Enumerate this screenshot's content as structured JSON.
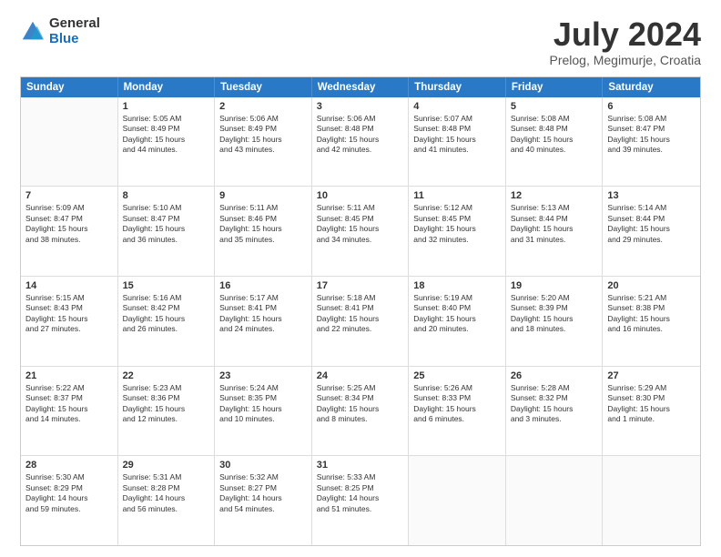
{
  "logo": {
    "general": "General",
    "blue": "Blue"
  },
  "header": {
    "title": "July 2024",
    "subtitle": "Prelog, Megimurje, Croatia"
  },
  "weekdays": [
    "Sunday",
    "Monday",
    "Tuesday",
    "Wednesday",
    "Thursday",
    "Friday",
    "Saturday"
  ],
  "weeks": [
    [
      {
        "day": "",
        "lines": []
      },
      {
        "day": "1",
        "lines": [
          "Sunrise: 5:05 AM",
          "Sunset: 8:49 PM",
          "Daylight: 15 hours",
          "and 44 minutes."
        ]
      },
      {
        "day": "2",
        "lines": [
          "Sunrise: 5:06 AM",
          "Sunset: 8:49 PM",
          "Daylight: 15 hours",
          "and 43 minutes."
        ]
      },
      {
        "day": "3",
        "lines": [
          "Sunrise: 5:06 AM",
          "Sunset: 8:48 PM",
          "Daylight: 15 hours",
          "and 42 minutes."
        ]
      },
      {
        "day": "4",
        "lines": [
          "Sunrise: 5:07 AM",
          "Sunset: 8:48 PM",
          "Daylight: 15 hours",
          "and 41 minutes."
        ]
      },
      {
        "day": "5",
        "lines": [
          "Sunrise: 5:08 AM",
          "Sunset: 8:48 PM",
          "Daylight: 15 hours",
          "and 40 minutes."
        ]
      },
      {
        "day": "6",
        "lines": [
          "Sunrise: 5:08 AM",
          "Sunset: 8:47 PM",
          "Daylight: 15 hours",
          "and 39 minutes."
        ]
      }
    ],
    [
      {
        "day": "7",
        "lines": [
          "Sunrise: 5:09 AM",
          "Sunset: 8:47 PM",
          "Daylight: 15 hours",
          "and 38 minutes."
        ]
      },
      {
        "day": "8",
        "lines": [
          "Sunrise: 5:10 AM",
          "Sunset: 8:47 PM",
          "Daylight: 15 hours",
          "and 36 minutes."
        ]
      },
      {
        "day": "9",
        "lines": [
          "Sunrise: 5:11 AM",
          "Sunset: 8:46 PM",
          "Daylight: 15 hours",
          "and 35 minutes."
        ]
      },
      {
        "day": "10",
        "lines": [
          "Sunrise: 5:11 AM",
          "Sunset: 8:45 PM",
          "Daylight: 15 hours",
          "and 34 minutes."
        ]
      },
      {
        "day": "11",
        "lines": [
          "Sunrise: 5:12 AM",
          "Sunset: 8:45 PM",
          "Daylight: 15 hours",
          "and 32 minutes."
        ]
      },
      {
        "day": "12",
        "lines": [
          "Sunrise: 5:13 AM",
          "Sunset: 8:44 PM",
          "Daylight: 15 hours",
          "and 31 minutes."
        ]
      },
      {
        "day": "13",
        "lines": [
          "Sunrise: 5:14 AM",
          "Sunset: 8:44 PM",
          "Daylight: 15 hours",
          "and 29 minutes."
        ]
      }
    ],
    [
      {
        "day": "14",
        "lines": [
          "Sunrise: 5:15 AM",
          "Sunset: 8:43 PM",
          "Daylight: 15 hours",
          "and 27 minutes."
        ]
      },
      {
        "day": "15",
        "lines": [
          "Sunrise: 5:16 AM",
          "Sunset: 8:42 PM",
          "Daylight: 15 hours",
          "and 26 minutes."
        ]
      },
      {
        "day": "16",
        "lines": [
          "Sunrise: 5:17 AM",
          "Sunset: 8:41 PM",
          "Daylight: 15 hours",
          "and 24 minutes."
        ]
      },
      {
        "day": "17",
        "lines": [
          "Sunrise: 5:18 AM",
          "Sunset: 8:41 PM",
          "Daylight: 15 hours",
          "and 22 minutes."
        ]
      },
      {
        "day": "18",
        "lines": [
          "Sunrise: 5:19 AM",
          "Sunset: 8:40 PM",
          "Daylight: 15 hours",
          "and 20 minutes."
        ]
      },
      {
        "day": "19",
        "lines": [
          "Sunrise: 5:20 AM",
          "Sunset: 8:39 PM",
          "Daylight: 15 hours",
          "and 18 minutes."
        ]
      },
      {
        "day": "20",
        "lines": [
          "Sunrise: 5:21 AM",
          "Sunset: 8:38 PM",
          "Daylight: 15 hours",
          "and 16 minutes."
        ]
      }
    ],
    [
      {
        "day": "21",
        "lines": [
          "Sunrise: 5:22 AM",
          "Sunset: 8:37 PM",
          "Daylight: 15 hours",
          "and 14 minutes."
        ]
      },
      {
        "day": "22",
        "lines": [
          "Sunrise: 5:23 AM",
          "Sunset: 8:36 PM",
          "Daylight: 15 hours",
          "and 12 minutes."
        ]
      },
      {
        "day": "23",
        "lines": [
          "Sunrise: 5:24 AM",
          "Sunset: 8:35 PM",
          "Daylight: 15 hours",
          "and 10 minutes."
        ]
      },
      {
        "day": "24",
        "lines": [
          "Sunrise: 5:25 AM",
          "Sunset: 8:34 PM",
          "Daylight: 15 hours",
          "and 8 minutes."
        ]
      },
      {
        "day": "25",
        "lines": [
          "Sunrise: 5:26 AM",
          "Sunset: 8:33 PM",
          "Daylight: 15 hours",
          "and 6 minutes."
        ]
      },
      {
        "day": "26",
        "lines": [
          "Sunrise: 5:28 AM",
          "Sunset: 8:32 PM",
          "Daylight: 15 hours",
          "and 3 minutes."
        ]
      },
      {
        "day": "27",
        "lines": [
          "Sunrise: 5:29 AM",
          "Sunset: 8:30 PM",
          "Daylight: 15 hours",
          "and 1 minute."
        ]
      }
    ],
    [
      {
        "day": "28",
        "lines": [
          "Sunrise: 5:30 AM",
          "Sunset: 8:29 PM",
          "Daylight: 14 hours",
          "and 59 minutes."
        ]
      },
      {
        "day": "29",
        "lines": [
          "Sunrise: 5:31 AM",
          "Sunset: 8:28 PM",
          "Daylight: 14 hours",
          "and 56 minutes."
        ]
      },
      {
        "day": "30",
        "lines": [
          "Sunrise: 5:32 AM",
          "Sunset: 8:27 PM",
          "Daylight: 14 hours",
          "and 54 minutes."
        ]
      },
      {
        "day": "31",
        "lines": [
          "Sunrise: 5:33 AM",
          "Sunset: 8:25 PM",
          "Daylight: 14 hours",
          "and 51 minutes."
        ]
      },
      {
        "day": "",
        "lines": []
      },
      {
        "day": "",
        "lines": []
      },
      {
        "day": "",
        "lines": []
      }
    ]
  ]
}
